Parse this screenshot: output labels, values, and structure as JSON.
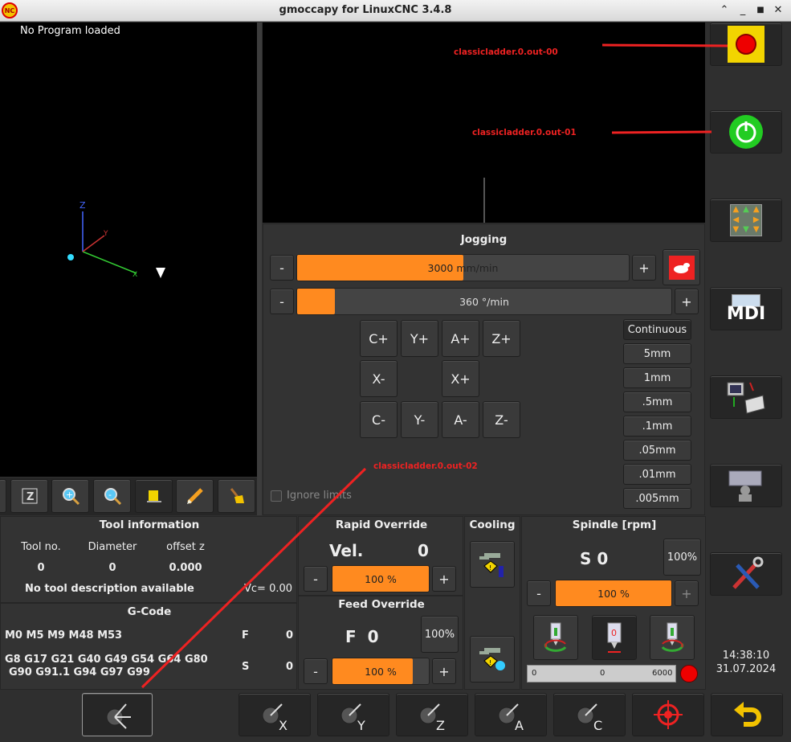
{
  "window": {
    "title": "gmoccapy for LinuxCNC  3.4.8",
    "logo_text": "NC"
  },
  "preview": {
    "status": "No Program loaded",
    "axes": {
      "z": "Z",
      "y": "Y",
      "x": "X"
    }
  },
  "hal_labels": {
    "out0": "classicladder.0.out-00",
    "out1": "classicladder.0.out-01",
    "out2": "classicladder.0.out-02"
  },
  "jog": {
    "title": "Jogging",
    "minus": "-",
    "plus": "+",
    "linear_speed": "3000 mm/min",
    "linear_fraction": 0.5,
    "angular_speed": "360 °/min",
    "angular_fraction": 0.1,
    "buttons": [
      "C+",
      "Y+",
      "A+",
      "Z+",
      "X-",
      "X+",
      "C-",
      "Y-",
      "A-",
      "Z-"
    ],
    "increments": [
      "Continuous",
      "5mm",
      "1mm",
      ".5mm",
      ".1mm",
      ".05mm",
      ".01mm",
      ".005mm"
    ],
    "ignore_limits": "Ignore limits"
  },
  "tool": {
    "title": "Tool information",
    "cols": [
      "Tool no.",
      "Diameter",
      "offset z"
    ],
    "values": [
      "0",
      "0",
      "0.000"
    ],
    "description": "No tool description available",
    "vc": "Vc= 0.00"
  },
  "gcode": {
    "title": "G-Code",
    "line1": "M0 M5 M9 M48 M53",
    "line2": "G8 G17 G21 G40 G49 G54 G64 G80",
    "line3": "G90 G91.1 G94 G97 G99",
    "f_label": "F",
    "f_value": "0",
    "s_label": "S",
    "s_value": "0"
  },
  "rapid": {
    "title": "Rapid Override",
    "vel_label": "Vel.",
    "vel_value": "0",
    "percent": "100 %",
    "fraction": 1.0
  },
  "feed": {
    "title": "Feed Override",
    "f_label": "F  0",
    "reset": "100%",
    "percent": "100 %",
    "fraction": 1.0
  },
  "cooling": {
    "title": "Cooling"
  },
  "spindle": {
    "title": "Spindle [rpm]",
    "s_label": "S 0",
    "reset": "100%",
    "percent": "100 %",
    "fraction": 1.0,
    "ccw_display": "0",
    "scale_min": "0",
    "scale_mid": "0",
    "scale_max": "6000"
  },
  "clock": {
    "time": "14:38:10",
    "date": "31.07.2024"
  },
  "sidebar": {
    "mdi": "MDI"
  },
  "bottom": {
    "axes": [
      "X",
      "Y",
      "Z",
      "A",
      "C"
    ]
  },
  "colors": {
    "accent": "#ff8a1f",
    "estop": "#f2d400",
    "power": "#22cc22",
    "hal_red": "#e22222"
  }
}
